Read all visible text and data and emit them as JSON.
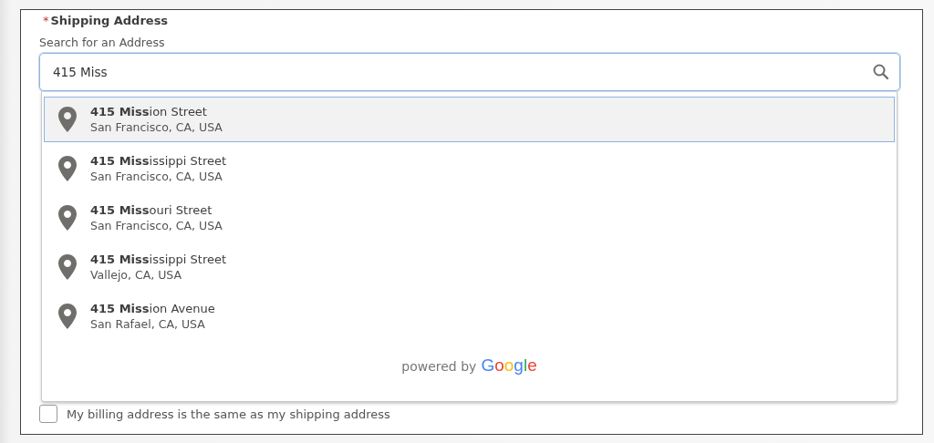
{
  "field": {
    "required_mark": "*",
    "title": "Shipping Address",
    "label": "Search for an Address",
    "value": "415 Miss"
  },
  "suggestions": [
    {
      "line1": "**415 Miss**ion Street",
      "line2": "San Francisco, CA, USA",
      "selected": true
    },
    {
      "line1": "**415 Miss**issippi Street",
      "line2": "San Francisco, CA, USA",
      "selected": false
    },
    {
      "line1": "**415 Miss**ouri Street",
      "line2": "San Francisco, CA, USA",
      "selected": false
    },
    {
      "line1": "**415 Miss**issippi Street",
      "line2": "Vallejo, CA, USA",
      "selected": false
    },
    {
      "line1": "**415 Miss**ion Avenue",
      "line2": "San Rafael, CA, USA",
      "selected": false
    }
  ],
  "attribution": {
    "prefix": "powered by",
    "brand": "Google"
  },
  "billing_same": {
    "label": "My billing address is the same as my shipping address",
    "checked": false
  }
}
